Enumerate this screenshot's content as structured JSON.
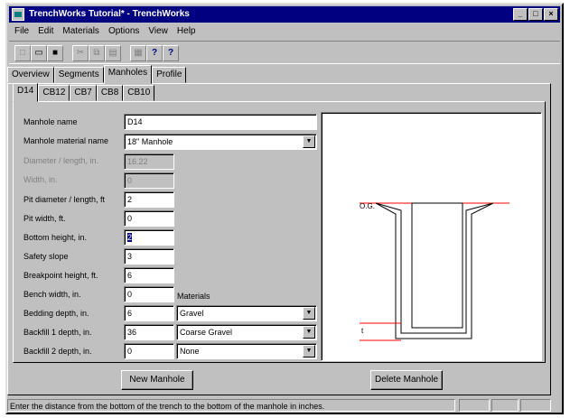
{
  "window": {
    "title": "TrenchWorks Tutorial* - TrenchWorks"
  },
  "window_buttons": [
    "_",
    "□",
    "×"
  ],
  "menu": [
    "File",
    "Edit",
    "Materials",
    "Options",
    "View",
    "Help"
  ],
  "toolbar": [
    {
      "name": "new-icon",
      "glyph": "□"
    },
    {
      "name": "open-icon",
      "glyph": "▭"
    },
    {
      "name": "save-icon",
      "glyph": "■"
    },
    {
      "name": "cut-icon",
      "glyph": "✂"
    },
    {
      "name": "copy-icon",
      "glyph": "⧉"
    },
    {
      "name": "paste-icon",
      "glyph": "▤"
    },
    {
      "name": "print-icon",
      "glyph": "▦"
    },
    {
      "name": "help-icon",
      "glyph": "?"
    },
    {
      "name": "context-help-icon",
      "glyph": "?"
    }
  ],
  "main_tabs": [
    "Overview",
    "Segments",
    "Manholes",
    "Profile"
  ],
  "manhole_tabs": [
    "D14",
    "CB12",
    "CB7",
    "CB8",
    "CB10"
  ],
  "form": {
    "manhole_name": {
      "label": "Manhole name",
      "value": "D14"
    },
    "material_name": {
      "label": "Manhole material name",
      "value": "18\" Manhole"
    },
    "diameter": {
      "label": "Diameter / length, in.",
      "value": "16.22"
    },
    "width": {
      "label": "Width, in.",
      "value": "0"
    },
    "pit_diameter": {
      "label": "Pit diameter / length, ft",
      "value": "2"
    },
    "pit_width": {
      "label": "Pit width, ft.",
      "value": "0"
    },
    "bottom_height": {
      "label": "Bottom height, in.",
      "value": "2"
    },
    "safety_slope": {
      "label": "Safety slope",
      "value": "3"
    },
    "breakpoint_height": {
      "label": "Breakpoint height, ft.",
      "value": "6"
    },
    "bench_width": {
      "label": "Bench width, in.",
      "value": "0"
    },
    "materials_label": "Materials",
    "bedding_depth": {
      "label": "Bedding depth, in.",
      "value": "6",
      "material": "Gravel"
    },
    "backfill1_depth": {
      "label": "Backfill 1 depth, in.",
      "value": "36",
      "material": "Coarse Gravel"
    },
    "backfill2_depth": {
      "label": "Backfill 2 depth, in.",
      "value": "0",
      "material": "None"
    }
  },
  "preview": {
    "og_label": "O.G.",
    "bottom_label": "t"
  },
  "buttons": {
    "new_manhole": "New Manhole",
    "delete_manhole": "Delete Manhole"
  },
  "status": "Enter the distance from the bottom of the trench to the bottom of the manhole in inches.",
  "colors": {
    "titlebar": "#000080",
    "face": "#c0c0c0",
    "preview_red": "#ff0000"
  }
}
